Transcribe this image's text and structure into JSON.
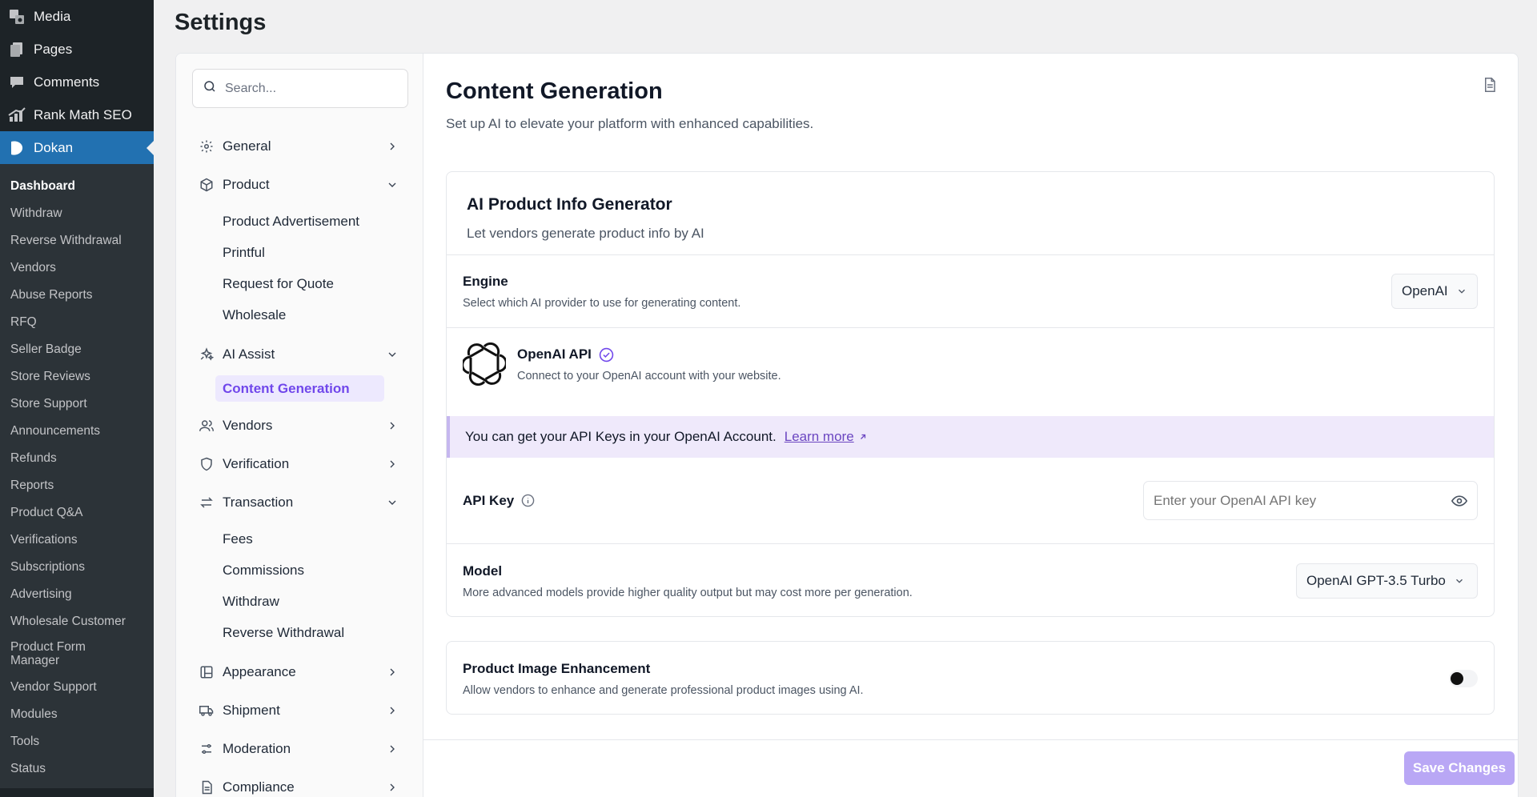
{
  "wp_menu": {
    "top_items": [
      {
        "label": "Media",
        "icon": "media-icon"
      },
      {
        "label": "Pages",
        "icon": "pages-icon"
      },
      {
        "label": "Comments",
        "icon": "comments-icon"
      },
      {
        "label": "Rank Math SEO",
        "icon": "rank-math-icon"
      },
      {
        "label": "Dokan",
        "icon": "dokan-icon"
      }
    ],
    "submenu": [
      "Dashboard",
      "Withdraw",
      "Reverse Withdrawal",
      "Vendors",
      "Abuse Reports",
      "RFQ",
      "Seller Badge",
      "Store Reviews",
      "Store Support",
      "Announcements",
      "Refunds",
      "Reports",
      "Product Q&A",
      "Verifications",
      "Subscriptions",
      "Advertising",
      "Wholesale Customer",
      "Product Form Manager",
      "Vendor Support",
      "Modules",
      "Tools",
      "Status"
    ]
  },
  "page_title": "Settings",
  "search": {
    "placeholder": "Search..."
  },
  "nav": {
    "general": "General",
    "product": "Product",
    "product_sub": [
      "Product Advertisement",
      "Printful",
      "Request for Quote",
      "Wholesale"
    ],
    "ai_assist": "AI Assist",
    "ai_assist_sub": [
      "Content Generation"
    ],
    "vendors": "Vendors",
    "verification": "Verification",
    "transaction": "Transaction",
    "transaction_sub": [
      "Fees",
      "Commissions",
      "Withdraw",
      "Reverse Withdrawal"
    ],
    "appearance": "Appearance",
    "shipment": "Shipment",
    "moderation": "Moderation",
    "compliance": "Compliance"
  },
  "content": {
    "title": "Content Generation",
    "subtitle": "Set up AI to elevate your platform with enhanced capabilities."
  },
  "generator": {
    "title": "AI Product Info Generator",
    "subtitle": "Let vendors generate product info by AI",
    "engine": {
      "label": "Engine",
      "desc": "Select which AI provider to use for generating content.",
      "value": "OpenAI"
    },
    "openai": {
      "title": "OpenAI API",
      "desc": "Connect to your OpenAI account with your website."
    },
    "notice": {
      "text": "You can get your API Keys in your OpenAI Account.",
      "link": "Learn more"
    },
    "api_key": {
      "label": "API Key",
      "placeholder": "Enter your OpenAI API key"
    },
    "model": {
      "label": "Model",
      "desc": "More advanced models provide higher quality output but may cost more per generation.",
      "value": "OpenAI GPT-3.5 Turbo"
    }
  },
  "image_enhancement": {
    "title": "Product Image Enhancement",
    "desc": "Allow vendors to enhance and generate professional product images using AI.",
    "enabled": false
  },
  "save_label": "Save Changes",
  "colors": {
    "accent": "#7047eb",
    "wp_active": "#2271b1",
    "save_disabled": "#b9a7f5"
  }
}
